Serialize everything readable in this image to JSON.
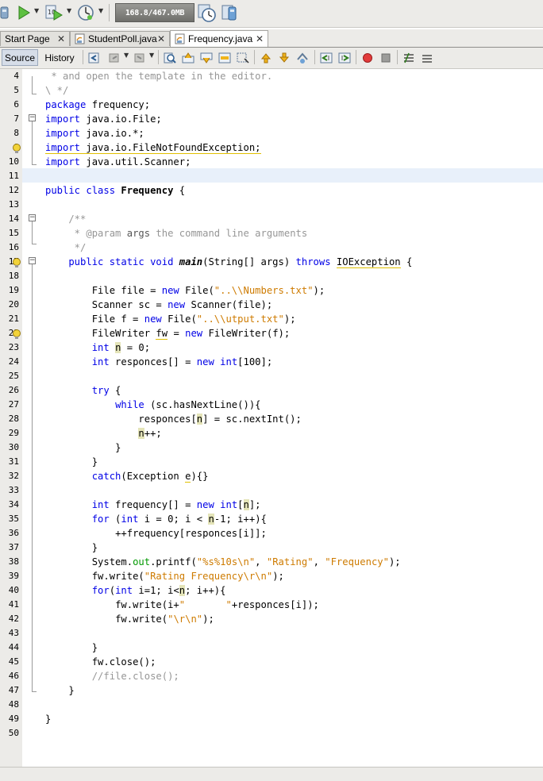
{
  "toolbar": {
    "memory": "168.8/467.0MB",
    "icons": [
      "hammer-icon",
      "run-icon",
      "debug-icon",
      "profile-icon",
      "gc-icon",
      "profile-snapshot-icon"
    ]
  },
  "tabs": [
    {
      "label": "Start Page"
    },
    {
      "label": "StudentPoll.java"
    },
    {
      "label": "Frequency.java"
    }
  ],
  "editor_toolbar": {
    "source": "Source",
    "history": "History"
  },
  "colors": {
    "keyword": "#0000e6",
    "string": "#ce7b00",
    "comment": "#969696",
    "field": "#009900",
    "current_line": "#e8f0fa"
  },
  "code": {
    "line_numbers": [
      "4",
      "5",
      "6",
      "7",
      "8",
      "9",
      "10",
      "11",
      "12",
      "13",
      "14",
      "15",
      "16",
      "17",
      "18",
      "19",
      "20",
      "21",
      "22",
      "23",
      "24",
      "25",
      "26",
      "27",
      "28",
      "29",
      "30",
      "31",
      "32",
      "33",
      "34",
      "35",
      "36",
      "37",
      "38",
      "39",
      "40",
      "41",
      "42",
      "43",
      "44",
      "45",
      "46",
      "47",
      "48",
      "49",
      "50"
    ],
    "l4": " * and open the template in the editor.",
    "l5": "\\ */",
    "l6a": "package",
    "l6b": " frequency;",
    "l7a": "import",
    "l7b": " java.io.File;",
    "l8a": "import",
    "l8b": " java.io.*;",
    "l9a": "import",
    "l9b": " java.io.FileNotFoundException;",
    "l10a": "import",
    "l10b": " java.util.Scanner;",
    "l12a": "public class",
    "l12b": " Frequency",
    "l12c": " {",
    "l14": "    /**",
    "l15a": "     * @param ",
    "l15b": "args",
    "l15c": " the command line arguments",
    "l16": "     */",
    "l17a": "    public static void ",
    "l17b": "main",
    "l17c": "(String[] args) ",
    "l17d": "throws",
    "l17e": " ",
    "l17f": "IOException",
    "l17g": " {",
    "l19a": "        File file = ",
    "l19b": "new",
    "l19c": " File(",
    "l19d": "\"..\\\\Numbers.txt\"",
    "l19e": ");",
    "l20a": "        Scanner sc = ",
    "l20b": "new",
    "l20c": " Scanner(file);",
    "l21a": "        File f = ",
    "l21b": "new",
    "l21c": " File(",
    "l21d": "\"..\\\\utput.txt\"",
    "l21e": ");",
    "l22a": "        FileWriter ",
    "l22b": "fw",
    "l22c": " = ",
    "l22d": "new",
    "l22e": " FileWriter(f);",
    "l23a": "int",
    "l23b": "n",
    "l23c": " = 0;",
    "l24a": "int",
    "l24b": " responces[] = ",
    "l24c": "new",
    "l24d": " ",
    "l24e": "int",
    "l24f": "[100];",
    "l26a": "try",
    "l26b": " {",
    "l27a": "while",
    "l27b": " (sc.hasNextLine()){",
    "l28a": "responces[",
    "l28b": "n",
    "l28c": "] = sc.nextInt();",
    "l29a": "n",
    "l29b": "++;",
    "l30": "}",
    "l31": "}",
    "l32a": "catch",
    "l32b": "(Exception ",
    "l32c": "e",
    "l32d": "){}",
    "l34a": "int",
    "l34b": " frequency[] = ",
    "l34c": "new",
    "l34d": " ",
    "l34e": "int",
    "l34f": "[",
    "l34g": "n",
    "l34h": "];",
    "l35a": "for",
    "l35b": " (",
    "l35c": "int",
    "l35d": " i = 0; i < ",
    "l35e": "n",
    "l35f": "-1; i++){",
    "l36": "++frequency[responces[i]];",
    "l37": "}",
    "l38a": "System.",
    "l38b": "out",
    "l38c": ".printf(",
    "l38d": "\"%s%10s\\n\"",
    "l38e": ", ",
    "l38f": "\"Rating\"",
    "l38g": ", ",
    "l38h": "\"Frequency\"",
    "l38i": ");",
    "l39a": "fw.write(",
    "l39b": "\"Rating Frequency\\r\\n\"",
    "l39c": ");",
    "l40a": "for",
    "l40b": "(",
    "l40c": "int",
    "l40d": " i=1; i<",
    "l40e": "n",
    "l40f": "; i++){",
    "l41a": "fw.write(i+",
    "l41b": "\"       \"",
    "l41c": "+responces[i]);",
    "l42a": "fw.write(",
    "l42b": "\"\\r\\n\"",
    "l42c": ");",
    "l44": "}",
    "l45": "fw.close();",
    "l46": "//file.close();",
    "l47": "}",
    "l49": "}"
  }
}
